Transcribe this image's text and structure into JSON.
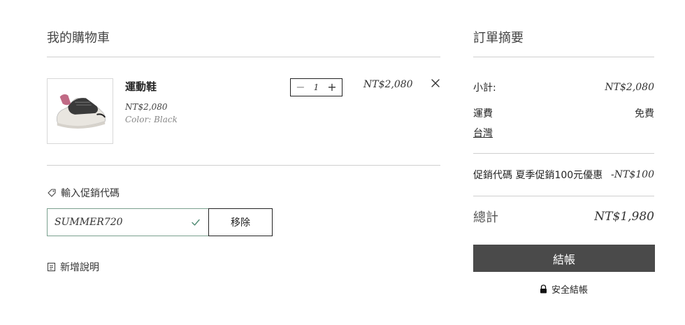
{
  "cart": {
    "title": "我的購物車",
    "item": {
      "name": "運動鞋",
      "price": "NT$2,080",
      "color": "Color: Black",
      "quantity": "1",
      "line_total": "NT$2,080"
    },
    "promo": {
      "label": "輸入促銷代碼",
      "code": "SUMMER720",
      "remove_label": "移除"
    },
    "note_label": "新增說明"
  },
  "summary": {
    "title": "訂單摘要",
    "subtotal_label": "小計:",
    "subtotal_value": "NT$2,080",
    "shipping_label": "運費",
    "shipping_value": "免費",
    "shipping_region": "台灣",
    "discount_label": "促銷代碼 夏季促銷100元優惠",
    "discount_value": "-NT$100",
    "total_label": "總計",
    "total_value": "NT$1,980",
    "checkout_label": "結帳",
    "secure_label": "安全結帳"
  },
  "colors": {
    "checkout_bg": "#4a4a4a",
    "promo_border": "#7aa08e",
    "rule": "#cfcfcf"
  }
}
